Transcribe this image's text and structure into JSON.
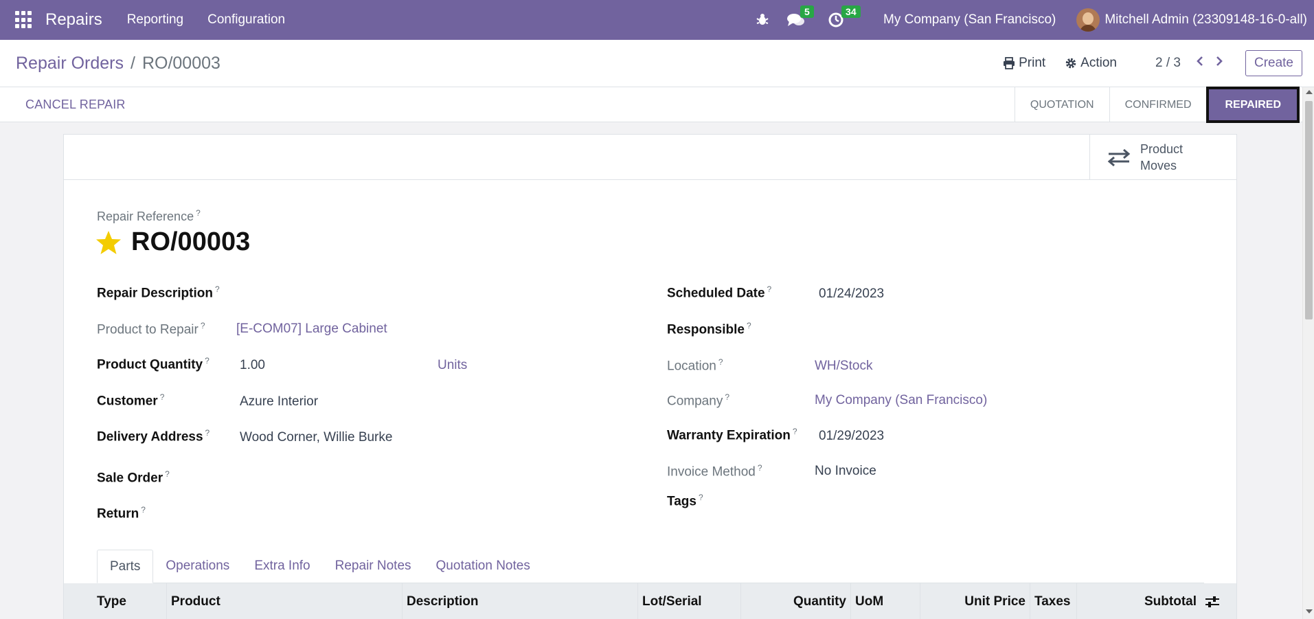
{
  "navbar": {
    "app_name": "Repairs",
    "menus": [
      "Reporting",
      "Configuration"
    ],
    "messages_count": "5",
    "activities_count": "34",
    "company": "My Company (San Francisco)",
    "user": "Mitchell Admin (23309148-16-0-all)",
    "bg_color": "#71639e"
  },
  "control": {
    "breadcrumb_parent": "Repair Orders",
    "breadcrumb_sep": "/",
    "breadcrumb_current": "RO/00003",
    "print_label": "Print",
    "action_label": "Action",
    "pager": "2 / 3",
    "create_label": "Create"
  },
  "statusbar": {
    "cancel_label": "CANCEL REPAIR",
    "stages": [
      "QUOTATION",
      "CONFIRMED",
      "REPAIRED"
    ],
    "active_stage": "REPAIRED"
  },
  "smart_button": {
    "line1": "Product",
    "line2": "Moves"
  },
  "form": {
    "ref_label": "Repair Reference",
    "title": "RO/00003",
    "left": {
      "repair_description": {
        "label": "Repair Description",
        "value": ""
      },
      "product_to_repair": {
        "label": "Product to Repair",
        "value": "[E-COM07] Large Cabinet"
      },
      "product_quantity": {
        "label": "Product Quantity",
        "value": "1.00",
        "uom": "Units"
      },
      "customer": {
        "label": "Customer",
        "value": "Azure Interior"
      },
      "delivery_address": {
        "label": "Delivery Address",
        "value": "Wood Corner, Willie Burke"
      },
      "sale_order": {
        "label": "Sale Order",
        "value": ""
      },
      "return": {
        "label": "Return",
        "value": ""
      }
    },
    "right": {
      "scheduled_date": {
        "label": "Scheduled Date",
        "value": "01/24/2023"
      },
      "responsible": {
        "label": "Responsible",
        "value": ""
      },
      "location": {
        "label": "Location",
        "value": "WH/Stock"
      },
      "company": {
        "label": "Company",
        "value": "My Company (San Francisco)"
      },
      "warranty_expiration": {
        "label": "Warranty Expiration",
        "value": "01/29/2023"
      },
      "invoice_method": {
        "label": "Invoice Method",
        "value": "No Invoice"
      },
      "tags": {
        "label": "Tags",
        "value": ""
      }
    }
  },
  "tabs": [
    "Parts",
    "Operations",
    "Extra Info",
    "Repair Notes",
    "Quotation Notes"
  ],
  "active_tab": "Parts",
  "table": {
    "columns": [
      "Type",
      "Product",
      "Description",
      "Lot/Serial",
      "Quantity",
      "UoM",
      "Unit Price",
      "Taxes",
      "Subtotal"
    ]
  }
}
